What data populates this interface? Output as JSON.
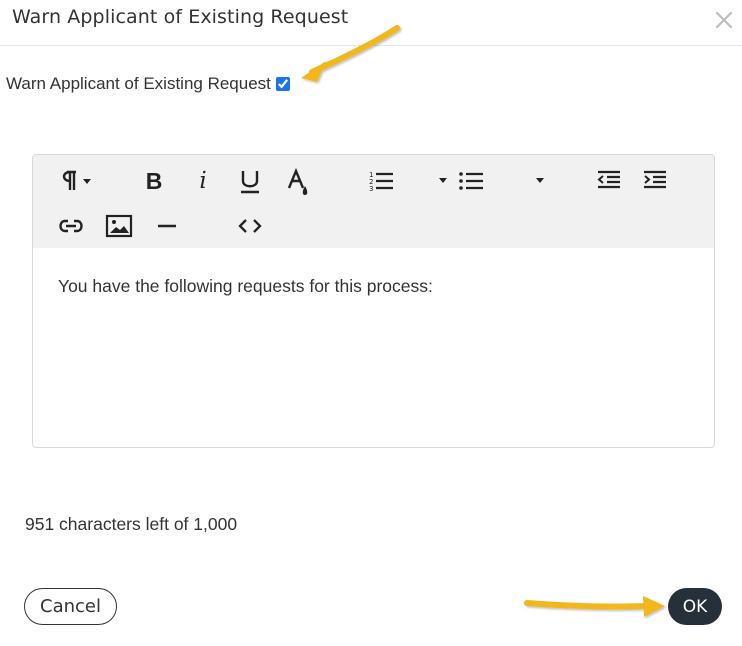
{
  "dialog": {
    "title": "Warn Applicant of Existing Request",
    "close_icon": "close-icon"
  },
  "warn_option": {
    "label": "Warn Applicant of Existing Request",
    "checked": true
  },
  "toolbar": {
    "items": [
      "paragraph-format",
      "bold",
      "italic",
      "underline",
      "text-color",
      "ordered-list",
      "unordered-list",
      "outdent",
      "indent",
      "insert-link",
      "insert-image",
      "horizontal-line",
      "code-view"
    ],
    "bold_label": "B",
    "italic_label": "i"
  },
  "editor": {
    "content": "You have the following requests for this process:"
  },
  "counter": {
    "text": "951 characters left of 1,000"
  },
  "buttons": {
    "cancel_label": "Cancel",
    "ok_label": "OK"
  },
  "colors": {
    "ok_background": "#26303a",
    "checkbox_accent": "#1a73e8",
    "annotation_arrow": "#f2b71b"
  }
}
